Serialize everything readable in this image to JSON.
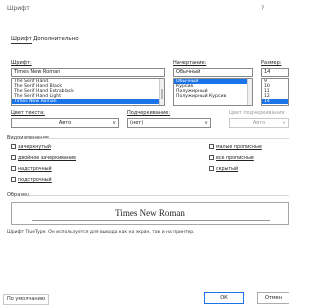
{
  "dialog": {
    "title": "Шрифт",
    "help": "?"
  },
  "tabs": [
    "Шрифт",
    "Дополнительно"
  ],
  "font": {
    "label": "Шрифт:",
    "value": "Times New Roman",
    "items": [
      "The Serif Hand",
      "The Serif Hand Black",
      "The Serif Hand Extrablack",
      "The Serif Hand Light",
      "Times New Roman"
    ],
    "selected_index": 4
  },
  "style": {
    "label": "Начертание:",
    "value": "Обычный",
    "items": [
      "Обычный",
      "Курсив",
      "Полужирный",
      "Полужирный Курсив"
    ],
    "selected_index": 0
  },
  "size": {
    "label": "Размер:",
    "value": "14",
    "items": [
      "9",
      "10",
      "11",
      "12",
      "14"
    ],
    "selected_index": 4
  },
  "color": {
    "label": "Цвет текста:",
    "value": "Авто"
  },
  "underline": {
    "label": "Подчеркивание:",
    "value": "(нет)"
  },
  "underline_color": {
    "label": "Цвет подчеркивания:",
    "value": "Авто"
  },
  "effects": {
    "label": "Видоизменение",
    "left": [
      "зачеркнутый",
      "двойное зачеркивание",
      "надстрочный",
      "подстрочный"
    ],
    "right": [
      "малые прописные",
      "все прописные",
      "скрытый"
    ]
  },
  "sample": {
    "label": "Образец",
    "text": "Times New Roman",
    "note": "Шрифт TrueType. Он используется для вывода как на экран, так и на принтер."
  },
  "buttons": {
    "default": "По умолчанию",
    "ok": "ОК",
    "cancel": "Отмен"
  },
  "colors": {
    "accent": "#1a73e8",
    "border": "#8a8a8a"
  }
}
